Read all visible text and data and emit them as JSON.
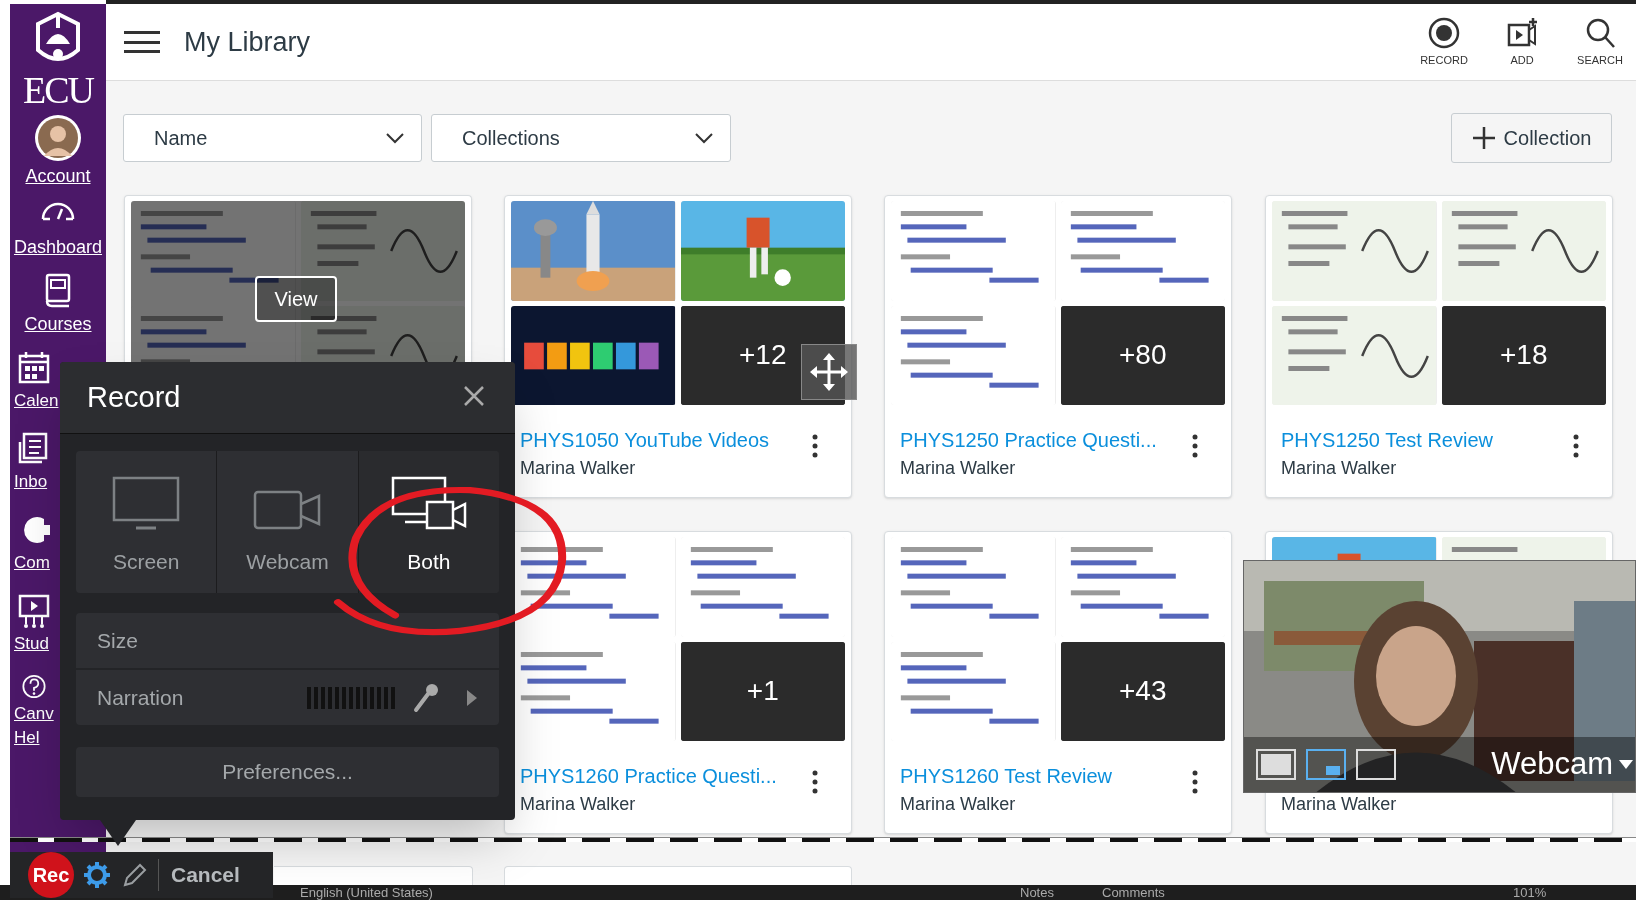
{
  "header": {
    "title": "My Library",
    "actions": [
      {
        "label": "RECORD",
        "kind": "record"
      },
      {
        "label": "ADD",
        "kind": "add"
      },
      {
        "label": "SEARCH",
        "kind": "search"
      }
    ]
  },
  "sidebar": {
    "logo": "ECU",
    "items": [
      {
        "label": "Account",
        "kind": "avatar"
      },
      {
        "label": "Dashboard",
        "kind": "dashboard"
      },
      {
        "label": "Courses",
        "kind": "courses"
      },
      {
        "label": "Calen",
        "kind": "calendar"
      },
      {
        "label": "Inbo",
        "kind": "inbox"
      },
      {
        "label": "Com",
        "kind": "commons"
      },
      {
        "label": "Stud",
        "kind": "studio"
      },
      {
        "label": "Canv\nHel",
        "kind": "help"
      }
    ]
  },
  "filters": [
    {
      "label": "Name"
    },
    {
      "label": "Collections"
    }
  ],
  "add_collection": {
    "label": "Collection"
  },
  "cards": [
    {
      "view_button": "View",
      "tiles": [
        {
          "kind": "picture"
        },
        {
          "kind": "picture"
        },
        {
          "kind": "picture"
        },
        {
          "kind": "picture"
        }
      ]
    },
    {
      "title": "PHYS1050 YouTube Videos",
      "author": "Marina Walker",
      "tiles": [
        {
          "kind": "picture"
        },
        {
          "kind": "picture"
        },
        {
          "kind": "picture"
        },
        {
          "kind": "count",
          "text": "+12"
        }
      ],
      "drag_handle": true
    },
    {
      "title": "PHYS1250 Practice Questi...",
      "author": "Marina Walker",
      "tiles": [
        {
          "kind": "picture"
        },
        {
          "kind": "picture"
        },
        {
          "kind": "picture"
        },
        {
          "kind": "count",
          "text": "+80"
        }
      ]
    },
    {
      "title": "PHYS1250 Test Review",
      "author": "Marina Walker",
      "tiles": [
        {
          "kind": "picture"
        },
        {
          "kind": "picture"
        },
        {
          "kind": "picture"
        },
        {
          "kind": "count",
          "text": "+18"
        }
      ]
    },
    {
      "title": "PHYS1260 Practice Questi...",
      "author": "Marina Walker",
      "tiles": [
        {
          "kind": "picture"
        },
        {
          "kind": "picture"
        },
        {
          "kind": "picture"
        },
        {
          "kind": "count",
          "text": "+1"
        }
      ]
    },
    {
      "title": "PHYS1260 Test Review",
      "author": "Marina Walker",
      "tiles": [
        {
          "kind": "picture"
        },
        {
          "kind": "picture"
        },
        {
          "kind": "picture"
        },
        {
          "kind": "count",
          "text": "+43"
        }
      ]
    },
    {
      "author": "Marina Walker",
      "tiles": [
        {
          "kind": "picture"
        },
        {
          "kind": "picture"
        }
      ]
    }
  ],
  "record_panel": {
    "title": "Record",
    "modes": [
      {
        "label": "Screen",
        "kind": "screen",
        "selected": false
      },
      {
        "label": "Webcam",
        "kind": "webcam",
        "selected": false
      },
      {
        "label": "Both",
        "kind": "both",
        "selected": true
      }
    ],
    "rows": [
      {
        "label": "Size",
        "kind": "size"
      },
      {
        "label": "Narration",
        "kind": "narration"
      }
    ],
    "preferences": "Preferences..."
  },
  "webcam_preview": {
    "label": "Webcam",
    "layouts": [
      {
        "selected": false
      },
      {
        "selected": true
      },
      {
        "selected": false
      }
    ]
  },
  "recorder_bar": {
    "rec": "Rec",
    "cancel": "Cancel"
  },
  "status_bar": {
    "language": "English (United States)",
    "notes": "Notes",
    "comments": "Comments",
    "zoom": "101%"
  }
}
